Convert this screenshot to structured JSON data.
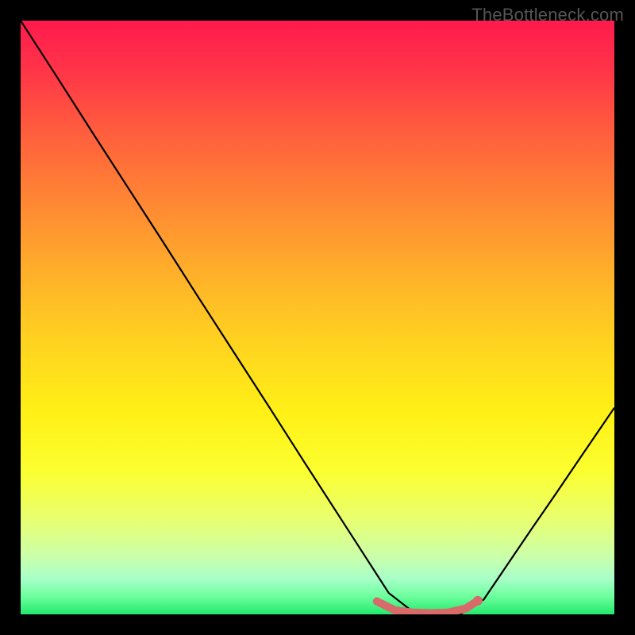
{
  "watermark": "TheBottleneck.com",
  "chart_data": {
    "type": "line",
    "title": "",
    "xlabel": "",
    "ylabel": "",
    "xlim": [
      0,
      100
    ],
    "ylim": [
      0,
      100
    ],
    "series": [
      {
        "name": "bottleneck-curve",
        "x": [
          0,
          6,
          12,
          18,
          24,
          30,
          36,
          42,
          48,
          54,
          58,
          62,
          66,
          70,
          74,
          78,
          82,
          86,
          90,
          94,
          100
        ],
        "values": [
          100,
          90.7,
          81.3,
          72,
          62.7,
          53.3,
          44,
          34.7,
          25.3,
          16,
          9.8,
          3.6,
          0.5,
          0,
          0,
          2.5,
          8.4,
          14.3,
          20.1,
          26,
          34.8
        ],
        "color": "#000000"
      },
      {
        "name": "sweet-spot-marker",
        "x": [
          60,
          63,
          66,
          69,
          72,
          75,
          77
        ],
        "values": [
          2.2,
          0.7,
          0.3,
          0.2,
          0.3,
          1.0,
          2.3
        ],
        "color": "#d86a6a"
      }
    ],
    "background_gradient": {
      "stops": [
        {
          "pos": 0,
          "color": "#ff1a4d"
        },
        {
          "pos": 8,
          "color": "#ff3348"
        },
        {
          "pos": 18,
          "color": "#ff5b3e"
        },
        {
          "pos": 30,
          "color": "#ff8534"
        },
        {
          "pos": 42,
          "color": "#ffae2a"
        },
        {
          "pos": 54,
          "color": "#ffd220"
        },
        {
          "pos": 66,
          "color": "#fff016"
        },
        {
          "pos": 76,
          "color": "#fbff30"
        },
        {
          "pos": 84,
          "color": "#e8ff70"
        },
        {
          "pos": 90,
          "color": "#ccffa8"
        },
        {
          "pos": 94,
          "color": "#a8ffc8"
        },
        {
          "pos": 97,
          "color": "#6cff9c"
        },
        {
          "pos": 100,
          "color": "#22e86c"
        }
      ]
    }
  }
}
